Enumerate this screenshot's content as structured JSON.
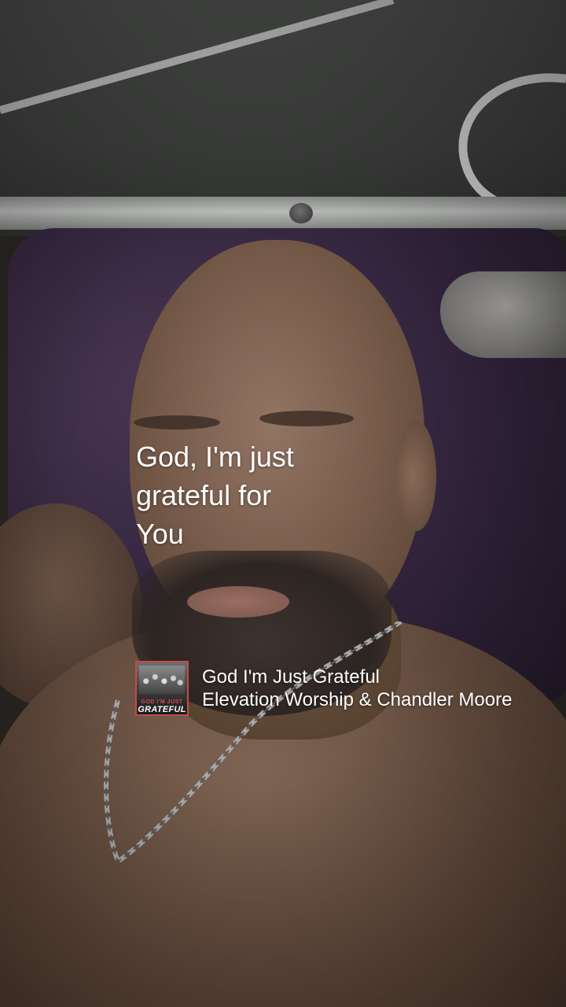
{
  "story": {
    "lyrics": {
      "line1": "God, I'm just",
      "line2": "grateful for",
      "line3": "You"
    },
    "music_sticker": {
      "album_art": {
        "small_text": "GOD I'M JUST",
        "big_text": "GRATEFUL",
        "border_color": "#c64a4a"
      },
      "track_title": "God I'm Just Grateful",
      "artist": "Elevation Worship & Chandler Moore"
    }
  },
  "colors": {
    "text": "#ffffff",
    "pillow": "#35263f"
  }
}
